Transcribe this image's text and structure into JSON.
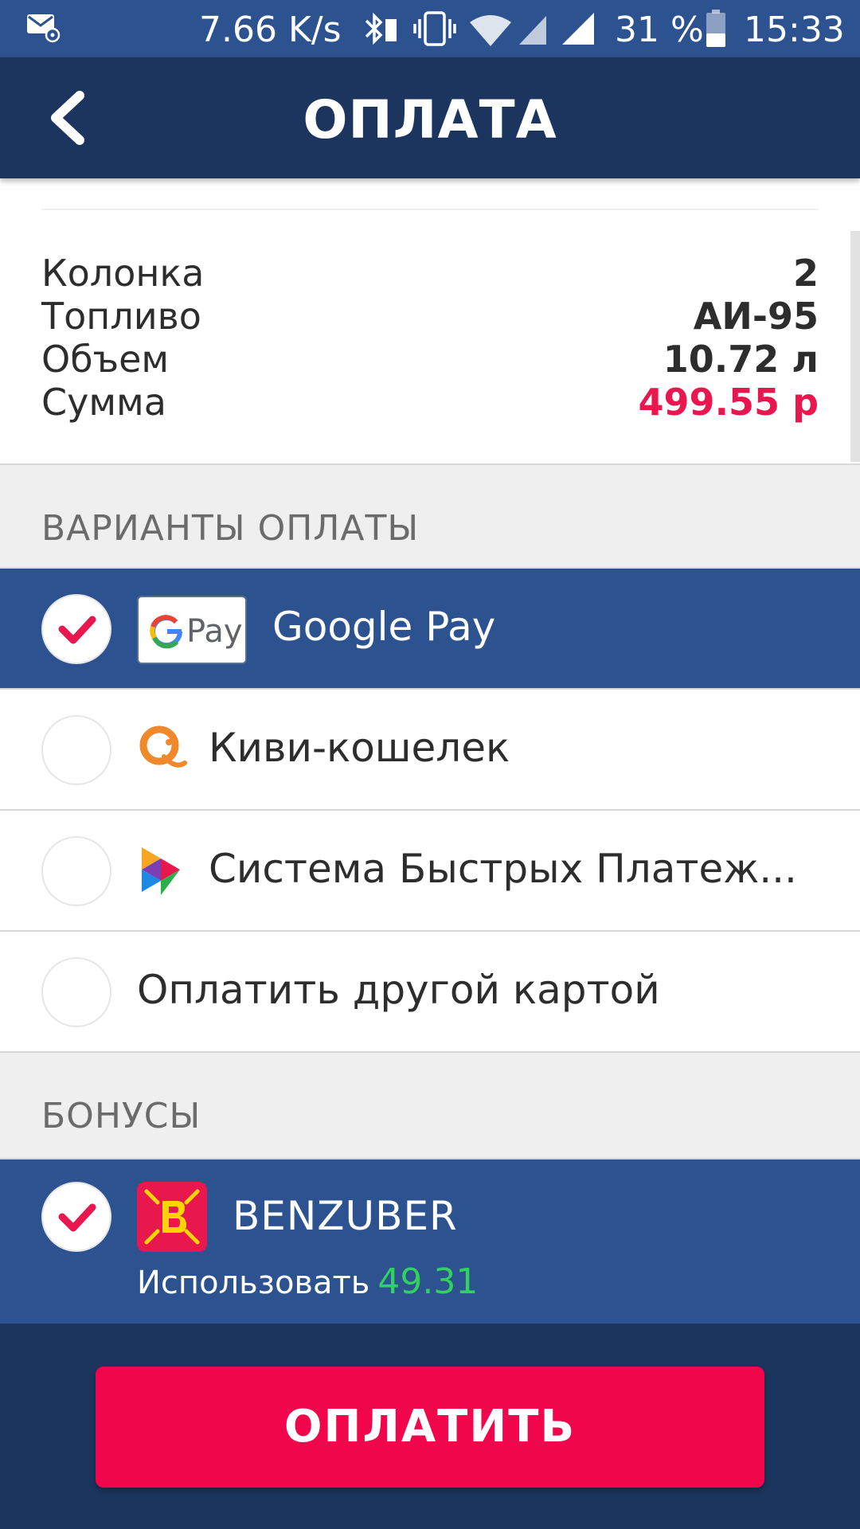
{
  "status_bar": {
    "network_speed": "7.66 K/s",
    "battery_percent": "31 %",
    "time": "15:33",
    "icons": [
      "mail-icon",
      "bluetooth-icon",
      "vibrate-icon",
      "wifi-icon",
      "signal-icon",
      "signal-icon",
      "battery-icon"
    ]
  },
  "header": {
    "title": "ОПЛАТА",
    "back_icon": "chevron-left-icon"
  },
  "order": {
    "rows": [
      {
        "label": "Колонка",
        "value": "2"
      },
      {
        "label": "Топливо",
        "value": "АИ-95"
      },
      {
        "label": "Объем",
        "value": "10.72 л"
      },
      {
        "label": "Сумма",
        "value": "499.55 р",
        "color": "#e8174d"
      }
    ]
  },
  "payment": {
    "section_title": "ВАРИАНТЫ ОПЛАТЫ",
    "options": [
      {
        "label": "Google Pay",
        "selected": true,
        "icon": "google-pay-icon",
        "badge_text": "Pay"
      },
      {
        "label": "Киви-кошелек",
        "selected": false,
        "icon": "qiwi-icon"
      },
      {
        "label": "Система Быстрых Платеж...",
        "selected": false,
        "icon": "sbp-icon"
      },
      {
        "label": "Оплатить другой картой",
        "selected": false
      }
    ]
  },
  "bonuses": {
    "section_title": "БОНУСЫ",
    "program": "BENZUBER",
    "selected": true,
    "use_label": "Использовать",
    "amount": "49.31",
    "icon": "benzuber-logo-icon"
  },
  "footer": {
    "pay_button": "ОПЛАТИТЬ"
  },
  "colors": {
    "primary": "#2d5290",
    "header": "#1c355e",
    "accent": "#e8174d",
    "button": "#f2064b",
    "bonus_amount": "#31d25f"
  }
}
